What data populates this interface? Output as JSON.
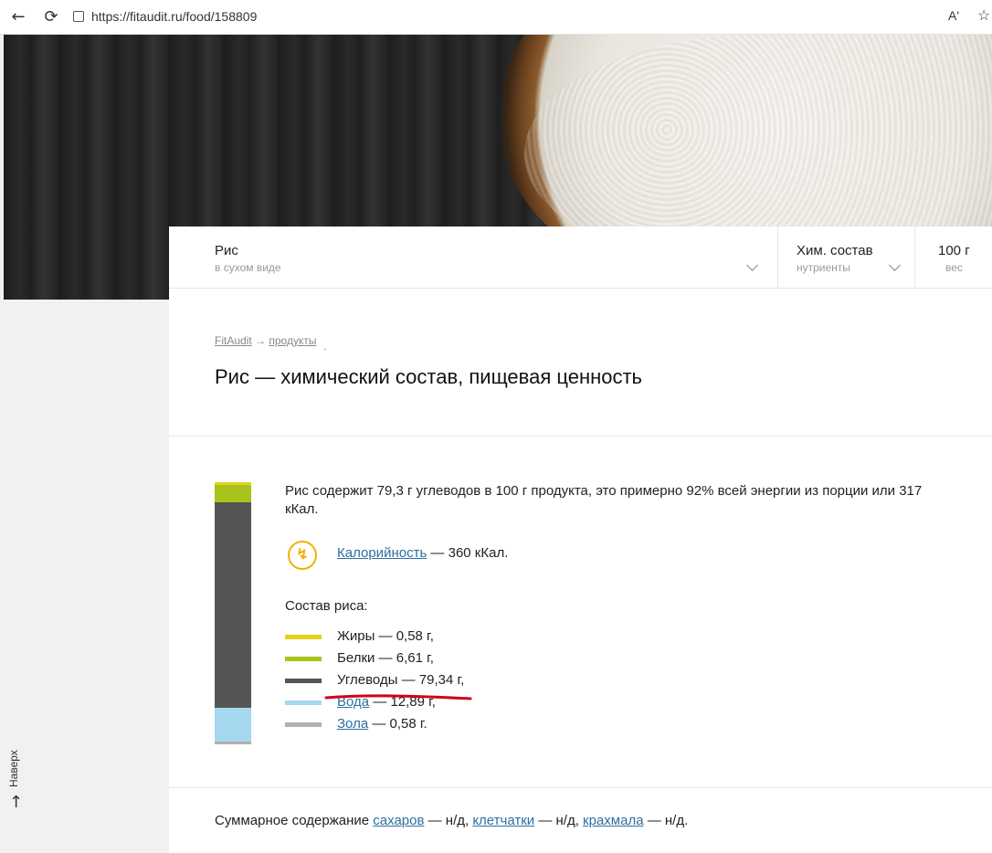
{
  "browser": {
    "url": "https://fitaudit.ru/food/158809",
    "back_icon": "arrow-left-icon",
    "reload_icon": "reload-icon",
    "read_label": "Aʹ"
  },
  "selector": {
    "product": {
      "title": "Рис",
      "sub": "в сухом виде"
    },
    "mode": {
      "title": "Хим. состав",
      "sub": "нутриенты"
    },
    "weight": {
      "title": "100 г",
      "sub": "вес"
    }
  },
  "breadcrumb": {
    "home": "FitAudit",
    "arrow": "→",
    "section": "продукты",
    "mark": "˼"
  },
  "page_title": "Рис — химический состав, пищевая ценность",
  "intro": "Рис содержит 79,3 г углеводов в 100 г продукта, это примерно 92% всей энергии из порции или 317 кКал.",
  "calories": {
    "link": "Калорийность",
    "rest": " — 360 кКал."
  },
  "composition": {
    "title": "Состав риса:",
    "items": [
      {
        "label": "Жиры",
        "text": " — 0,58 г,",
        "linked": false,
        "color": "#e6d11a",
        "value": 0.58
      },
      {
        "label": "Белки",
        "text": " — 6,61 г,",
        "linked": false,
        "color": "#a7c31c",
        "value": 6.61
      },
      {
        "label": "Углеводы",
        "text": " — 79,34 г,",
        "linked": false,
        "color": "#555555",
        "value": 79.34
      },
      {
        "label": "Вода",
        "text": " — 12,89 г,",
        "linked": true,
        "color": "#a6d8f0",
        "value": 12.89
      },
      {
        "label": "Зола",
        "text": " — 0,58 г.",
        "linked": true,
        "color": "#b0b0b0",
        "value": 0.58
      }
    ]
  },
  "summary": {
    "prefix": "Суммарное содержание ",
    "sugar": "сахаров",
    "sugar_val": " — н/д, ",
    "fiber": "клетчатки",
    "fiber_val": " — н/д, ",
    "starch": "крахмала",
    "starch_val": " — н/д."
  },
  "up_widget": {
    "label": "Наверх",
    "arrow": "↑"
  },
  "accent_colors": {
    "highlight": "#d0021b",
    "link": "#2f6f9f",
    "calorie_icon": "#f0b400"
  }
}
